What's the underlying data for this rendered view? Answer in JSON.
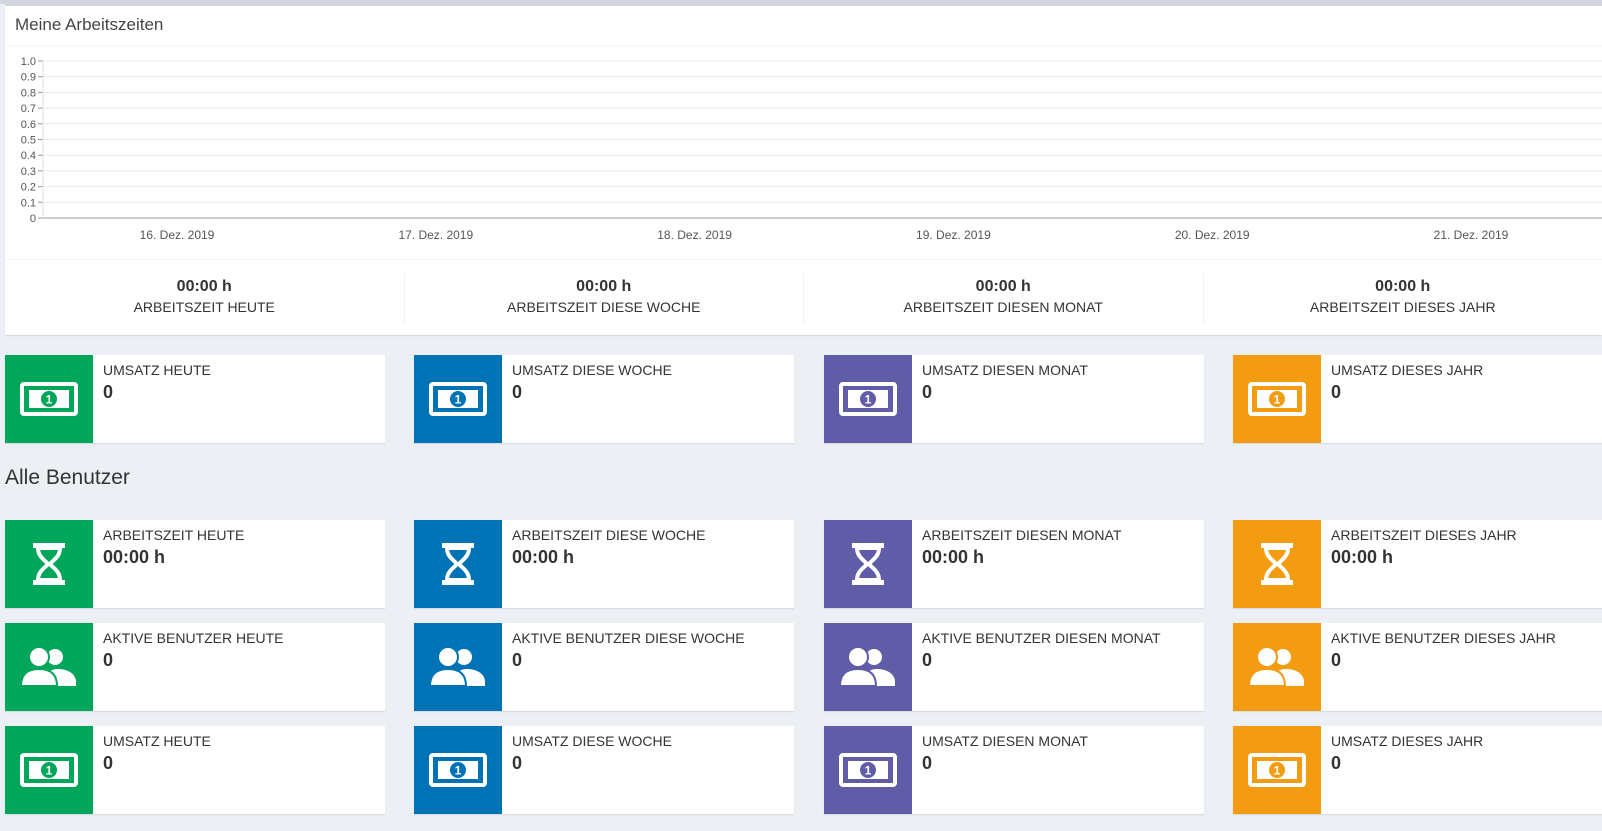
{
  "my_times": {
    "title": "Meine Arbeitszeiten",
    "stats": [
      {
        "value": "00:00 h",
        "label": "ARBEITSZEIT HEUTE"
      },
      {
        "value": "00:00 h",
        "label": "ARBEITSZEIT DIESE WOCHE"
      },
      {
        "value": "00:00 h",
        "label": "ARBEITSZEIT DIESEN MONAT"
      },
      {
        "value": "00:00 h",
        "label": "ARBEITSZEIT DIESES JAHR"
      }
    ]
  },
  "chart_data": {
    "type": "line",
    "title": "",
    "xlabel": "",
    "ylabel": "",
    "x": [
      "16. Dez. 2019",
      "17. Dez. 2019",
      "18. Dez. 2019",
      "19. Dez. 2019",
      "20. Dez. 2019",
      "21. Dez. 2019"
    ],
    "y_ticks": [
      "1.0",
      "0.9",
      "0.8",
      "0.7",
      "0.6",
      "0.5",
      "0.4",
      "0.3",
      "0.2",
      "0.1",
      "0"
    ],
    "ylim": [
      0,
      1
    ],
    "grid": true,
    "series": []
  },
  "my_revenue": [
    {
      "label": "UMSATZ HEUTE",
      "value": "0",
      "icon": "money-bill-icon",
      "color": "#00a65a"
    },
    {
      "label": "UMSATZ DIESE WOCHE",
      "value": "0",
      "icon": "money-bill-icon",
      "color": "#0073b7"
    },
    {
      "label": "UMSATZ DIESEN MONAT",
      "value": "0",
      "icon": "money-bill-icon",
      "color": "#605ca8"
    },
    {
      "label": "UMSATZ DIESES JAHR",
      "value": "0",
      "icon": "money-bill-icon",
      "color": "#f39c12"
    }
  ],
  "all_users": {
    "title": "Alle Benutzer",
    "worktime": [
      {
        "label": "ARBEITSZEIT HEUTE",
        "value": "00:00 h",
        "icon": "hourglass-icon",
        "color": "#00a65a"
      },
      {
        "label": "ARBEITSZEIT DIESE WOCHE",
        "value": "00:00 h",
        "icon": "hourglass-icon",
        "color": "#0073b7"
      },
      {
        "label": "ARBEITSZEIT DIESEN MONAT",
        "value": "00:00 h",
        "icon": "hourglass-icon",
        "color": "#605ca8"
      },
      {
        "label": "ARBEITSZEIT DIESES JAHR",
        "value": "00:00 h",
        "icon": "hourglass-icon",
        "color": "#f39c12"
      }
    ],
    "active_users": [
      {
        "label": "AKTIVE BENUTZER HEUTE",
        "value": "0",
        "icon": "users-icon",
        "color": "#00a65a"
      },
      {
        "label": "AKTIVE BENUTZER DIESE WOCHE",
        "value": "0",
        "icon": "users-icon",
        "color": "#0073b7"
      },
      {
        "label": "AKTIVE BENUTZER DIESEN MONAT",
        "value": "0",
        "icon": "users-icon",
        "color": "#605ca8"
      },
      {
        "label": "AKTIVE BENUTZER DIESES JAHR",
        "value": "0",
        "icon": "users-icon",
        "color": "#f39c12"
      }
    ],
    "revenue": [
      {
        "label": "UMSATZ HEUTE",
        "value": "0",
        "icon": "money-bill-icon",
        "color": "#00a65a"
      },
      {
        "label": "UMSATZ DIESE WOCHE",
        "value": "0",
        "icon": "money-bill-icon",
        "color": "#0073b7"
      },
      {
        "label": "UMSATZ DIESEN MONAT",
        "value": "0",
        "icon": "money-bill-icon",
        "color": "#605ca8"
      },
      {
        "label": "UMSATZ DIESES JAHR",
        "value": "0",
        "icon": "money-bill-icon",
        "color": "#f39c12"
      }
    ]
  }
}
